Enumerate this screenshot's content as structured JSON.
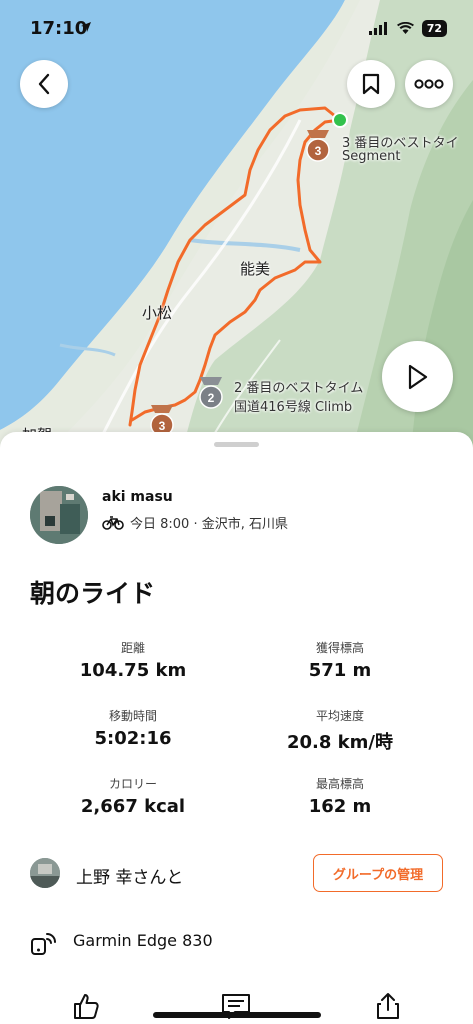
{
  "status_bar": {
    "time": "17:10",
    "battery": "72"
  },
  "map": {
    "segment3_line1": "3 番目のベストタイ",
    "segment3_line2": "Segment",
    "segment2_line1": "2 番目のベストタイム",
    "segment2_line2": "国道416号線 Climb",
    "city_nomi": "能美",
    "city_komatsu": "小松",
    "city_kaga": "加賀",
    "badge_3": "3",
    "badge_2": "2",
    "route_color": "#f26b2a",
    "start_color": "#33c24d"
  },
  "athlete": {
    "name": "aki masu",
    "meta": "今日 8:00 · 金沢市, 石川県"
  },
  "activity": {
    "title": "朝のライド"
  },
  "stats": [
    {
      "label": "距離",
      "value": "104.75 km"
    },
    {
      "label": "獲得標高",
      "value": "571 m"
    },
    {
      "label": "移動時間",
      "value": "5:02:16"
    },
    {
      "label": "平均速度",
      "value": "20.8 km/時"
    },
    {
      "label": "カロリー",
      "value": "2,667 kcal"
    },
    {
      "label": "最高標高",
      "value": "162 m"
    }
  ],
  "group": {
    "text": "上野 幸さんと",
    "button": "グループの管理"
  },
  "device": {
    "name": "Garmin Edge 830"
  },
  "icons": {
    "back": "chevron-left-icon",
    "bookmark": "bookmark-icon",
    "more": "more-icon",
    "play": "play-icon",
    "bike": "bike-icon",
    "device": "device-icon",
    "kudos": "thumbs-up-icon",
    "comment": "comment-icon",
    "share": "share-icon"
  }
}
